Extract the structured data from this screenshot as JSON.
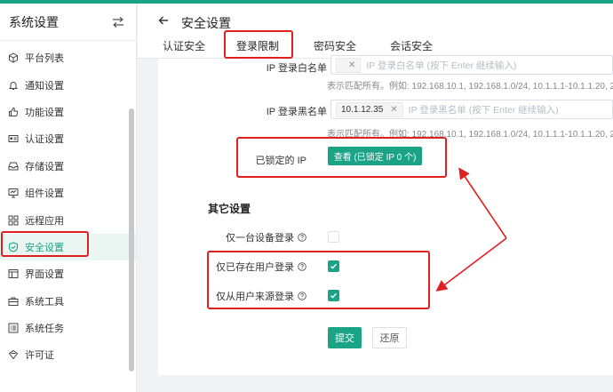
{
  "sidebar": {
    "title": "系统设置",
    "items": [
      {
        "label": "平台列表",
        "icon": "cube-icon"
      },
      {
        "label": "通知设置",
        "icon": "bell-icon"
      },
      {
        "label": "功能设置",
        "icon": "thumb-icon"
      },
      {
        "label": "认证设置",
        "icon": "id-card-icon"
      },
      {
        "label": "存储设置",
        "icon": "inbox-icon"
      },
      {
        "label": "组件设置",
        "icon": "monitor-icon"
      },
      {
        "label": "远程应用",
        "icon": "apps-icon"
      },
      {
        "label": "安全设置",
        "icon": "shield-icon",
        "active": true
      },
      {
        "label": "界面设置",
        "icon": "layout-icon"
      },
      {
        "label": "系统工具",
        "icon": "toolbox-icon"
      },
      {
        "label": "系统任务",
        "icon": "list-icon"
      },
      {
        "label": "许可证",
        "icon": "badge-icon"
      }
    ]
  },
  "header": {
    "title": "安全设置",
    "tabs": [
      {
        "label": "认证安全"
      },
      {
        "label": "登录限制",
        "active": true
      },
      {
        "label": "密码安全"
      },
      {
        "label": "会话安全"
      }
    ]
  },
  "form": {
    "whitelist": {
      "label": "IP 登录白名单",
      "tag": "",
      "placeholder": "IP 登录白名单 (按下 Enter 继续输入)",
      "hint": "表示匹配所有。例如: 192.168.10.1, 192.168.1.0/24, 10.1.1.1-10.1.1.20, 20..."
    },
    "blacklist": {
      "label": "IP 登录黑名单",
      "tag": "10.1.12.35",
      "placeholder": "IP 登录黑名单 (按下 Enter 继续输入)",
      "hint": "表示匹配所有。例如: 192.168.10.1, 192.168.1.0/24, 10.1.1.1-10.1.1.20, 20..."
    },
    "locked_ip": {
      "label": "已锁定的 IP",
      "button": "查看 (已锁定 IP 0 个)"
    },
    "other": {
      "title": "其它设置",
      "options": [
        {
          "label": "仅一台设备登录",
          "checked": false
        },
        {
          "label": "仅已存在用户登录",
          "checked": true
        },
        {
          "label": "仅从用户来源登录",
          "checked": true
        }
      ]
    },
    "submit": "提交",
    "reset": "还原"
  },
  "colors": {
    "accent": "#1aa385",
    "highlight": "#e02020"
  }
}
